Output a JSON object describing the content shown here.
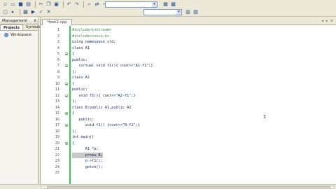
{
  "toolbar": {
    "row1_icons": [
      "new-file-icon",
      "open-icon",
      "save-icon",
      "save-all-icon",
      "cut-icon",
      "copy-icon",
      "paste-icon",
      "undo-icon",
      "redo-icon",
      "find-icon",
      "replace-icon",
      "goto-icon"
    ],
    "row2_icons": [
      "project-icon",
      "bookmark-icon",
      "compile-icon",
      "run-icon",
      "debug-icon",
      "stop-icon"
    ],
    "combo_value_1": "",
    "combo_value_2": ""
  },
  "sidebar": {
    "title": "Management",
    "close": "x",
    "tabs": [
      "Projects",
      "Symbols"
    ],
    "active_tab": "Projects",
    "workspace_label": "Workspace"
  },
  "editor": {
    "file_tab": "*test1.cpp",
    "tab_arrows": "◂ ▸ ×",
    "lines": [
      {
        "n": "1",
        "text": "#include<iostream>",
        "cls": "c-pre",
        "fold": ""
      },
      {
        "n": "2",
        "text": "#include<conio.h>",
        "cls": "c-pre",
        "fold": ""
      },
      {
        "n": "3",
        "text": "using namespace std;",
        "cls": "c-kw",
        "fold": ""
      },
      {
        "n": "4",
        "text": "class A1",
        "cls": "c-kw",
        "fold": ""
      },
      {
        "n": "5",
        "text": "{",
        "cls": "c-br",
        "fold": "open"
      },
      {
        "n": "6",
        "text": "public:",
        "cls": "c-kw",
        "fold": ""
      },
      {
        "n": "7",
        "text": "   virtual void f1(){ cout<<\"A1-f1\";}",
        "cls": "c-kw",
        "fold": "open"
      },
      {
        "n": "8",
        "text": "};",
        "cls": "c-br",
        "fold": ""
      },
      {
        "n": "9",
        "text": "class A2",
        "cls": "c-kw",
        "fold": ""
      },
      {
        "n": "10",
        "text": "{",
        "cls": "c-br",
        "fold": "open"
      },
      {
        "n": "11",
        "text": "public:",
        "cls": "c-kw",
        "fold": ""
      },
      {
        "n": "12",
        "text": "   void f1(){ cout<<\"A2-f1\";}",
        "cls": "c-kw",
        "fold": "open"
      },
      {
        "n": "13",
        "text": "};",
        "cls": "c-br",
        "fold": ""
      },
      {
        "n": "14",
        "text": "class B:public A1,public A2",
        "cls": "c-kw",
        "fold": ""
      },
      {
        "n": "15",
        "text": "{",
        "cls": "c-br",
        "fold": "open"
      },
      {
        "n": "16",
        "text": "   public:",
        "cls": "c-kw",
        "fold": ""
      },
      {
        "n": "17",
        "text": "      void f1() {cout<<\"B-f1\";}",
        "cls": "c-kw",
        "fold": "open"
      },
      {
        "n": "18",
        "text": "};",
        "cls": "c-br",
        "fold": ""
      },
      {
        "n": "19",
        "text": "int main()",
        "cls": "c-kw",
        "fold": ""
      },
      {
        "n": "20",
        "text": "{",
        "cls": "c-br",
        "fold": "open"
      },
      {
        "n": "21",
        "text": "      A1 *p;",
        "cls": "c-kw",
        "fold": ""
      },
      {
        "n": "22",
        "text": "      p=new B;",
        "cls": "c-kw c-hl",
        "fold": ""
      },
      {
        "n": "23",
        "text": "      p->f1();",
        "cls": "c-kw",
        "fold": ""
      },
      {
        "n": "24",
        "text": "      getch();",
        "cls": "c-kw",
        "fold": ""
      },
      {
        "n": "25",
        "text": "",
        "cls": "c-kw",
        "fold": ""
      }
    ],
    "text_cursor": "I"
  },
  "colors": {
    "change_bar": "#3cc55a",
    "preprocessor": "#3f8f3f",
    "keyword": "#1a2a6a"
  }
}
